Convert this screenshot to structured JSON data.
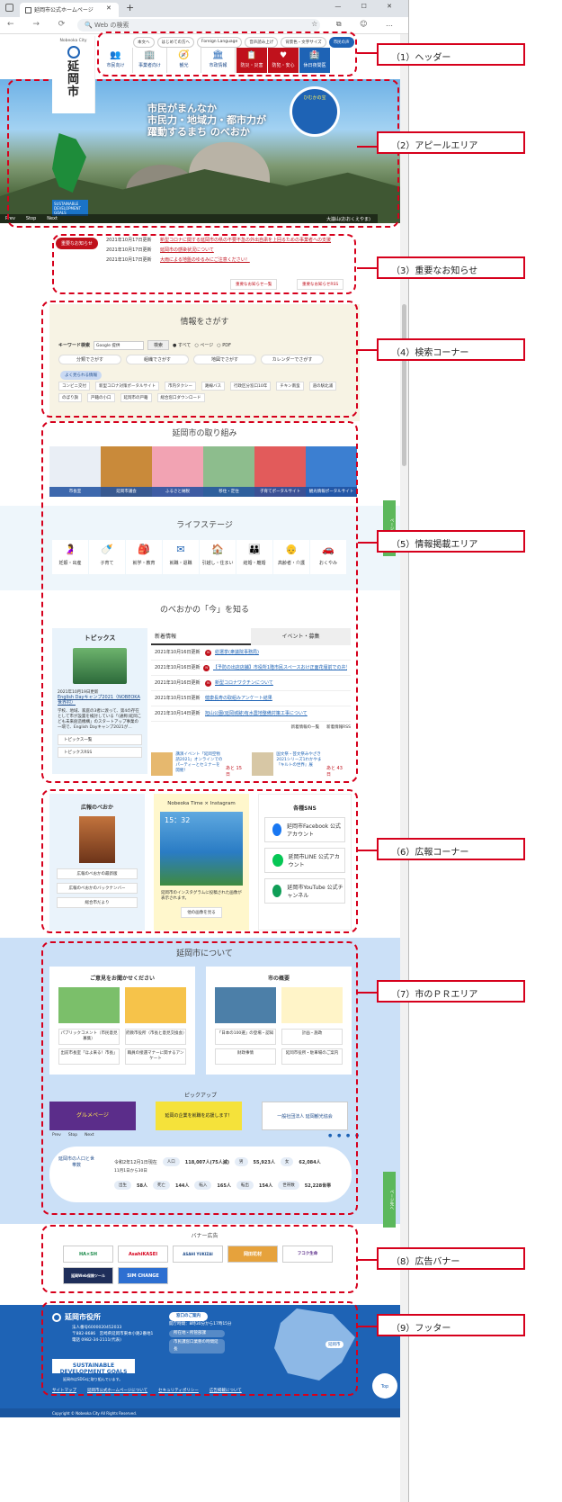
{
  "browser": {
    "tab_title": "延岡市公式ホームページ",
    "address_placeholder": "Web の検索"
  },
  "header": {
    "city_en": "Nobeoka City",
    "city_jp": "延岡市",
    "util": [
      "本文へ",
      "はじめての方へ",
      "Foreign Language",
      "音声読み上げ",
      "背景色・文字サイズ",
      "市民の声"
    ],
    "nav": [
      {
        "label": "市民向け",
        "icon": "👥"
      },
      {
        "label": "事業者向け",
        "icon": "🏢"
      },
      {
        "label": "観光",
        "icon": "🧭"
      },
      {
        "label": "市政情報",
        "icon": "🏛"
      }
    ],
    "nav_red": [
      {
        "label": "防災・災害",
        "icon": "📋"
      },
      {
        "label": "防犯・安心",
        "icon": "♥"
      }
    ],
    "nav_blue": {
      "label": "休日夜間医",
      "icon": "🏥"
    }
  },
  "hero": {
    "tagline": [
      "市民がまんなか",
      "市民力・地域力・都市力が",
      "躍動するまち のべおか"
    ],
    "circle_text": "ひむかの宝",
    "goals": "SUSTAINABLE DEVELOPMENT GOALS",
    "controls": [
      "Prev",
      "Stop",
      "Next"
    ],
    "caption": "大崩山(おおくえやま)"
  },
  "notice": {
    "label": "重要なお知らせ",
    "items": [
      {
        "date": "2021年10月17日更新",
        "text": "新型コロナに関する延岡市の県の不要不急の外出自粛を上回るための事業者への支援"
      },
      {
        "date": "2021年10月17日更新",
        "text": "延岡市の感染状況について"
      },
      {
        "date": "2021年10月17日更新",
        "text": "大雨による地盤のゆるみにご注意ください！"
      }
    ],
    "more1": "重要なお知らせ一覧",
    "more2": "重要なお知らせRSS"
  },
  "search": {
    "title": "情報をさがす",
    "kw_label": "キーワード検索",
    "kw_placeholder": "Google 提供",
    "kw_button": "検索",
    "scope": [
      "● すべて",
      "○ ページ",
      "○ PDF"
    ],
    "cats": [
      "分類でさがす",
      "組織でさがす",
      "地図でさがす",
      "カレンダーでさがす"
    ],
    "faq": "よく見られる情報",
    "tags": [
      "コンビニ交付",
      "新型コロナ対策ポータルサイト",
      "市内タクシー",
      "路線バス",
      "行政区分窓口10年",
      "チキン南蛮",
      "道の駅北浦",
      "のぼり旗",
      "戸籍の小口",
      "延岡市の戸籍",
      "総合窓口ダウンロード"
    ]
  },
  "initiatives": {
    "title": "延岡市の取り組み",
    "tiles": [
      {
        "label": "市長室",
        "color": "#e9eef5"
      },
      {
        "label": "延岡市議会",
        "color": "#c98a3a"
      },
      {
        "label": "ふるさと納税",
        "color": "#f2a3b3"
      },
      {
        "label": "移住・定住",
        "color": "#8dbd8d"
      },
      {
        "label": "子育てポータルサイト",
        "color": "#e25b5b"
      },
      {
        "label": "観光情報ポータルサイト",
        "color": "#3c7fd1"
      }
    ]
  },
  "lifestage": {
    "title": "ライフステージ",
    "items": [
      {
        "label": "妊娠・出産",
        "icon": "🤰"
      },
      {
        "label": "子育て",
        "icon": "🍼"
      },
      {
        "label": "就学・教育",
        "icon": "🎒"
      },
      {
        "label": "就職・退職",
        "icon": "✉"
      },
      {
        "label": "引越し・住まい",
        "icon": "🏠"
      },
      {
        "label": "結婚・離婚",
        "icon": "👪"
      },
      {
        "label": "高齢者・介護",
        "icon": "👴"
      },
      {
        "label": "おくやみ",
        "icon": "🚗"
      }
    ]
  },
  "now": {
    "title": "のべおかの「今」を知る",
    "topics": {
      "title": "トピックス",
      "date": "2021年10月19日更新",
      "link": "English Dayキャンプ2021（NOBEOKA 世界村）",
      "text": "学校、地域、家庭の3者に渡って、第4の存在として市が設置を検討している「(通称)延岡こども未来創造機構」のスタートアップ事業の一環で、English Dayキャンプ2021が…",
      "b1": "トピックス一覧",
      "b2": "トピックスRSS"
    },
    "tabs": [
      "新着情報",
      "イベント・募集"
    ],
    "news": [
      {
        "date": "2021年10月16日更新",
        "new": true,
        "text": "総選挙(衆議院事務局)"
      },
      {
        "date": "2021年10月16日更新",
        "new": true,
        "text": "【予防の出店店舗】市役所1階市民スペースおけ正面花壇前での弁当販売"
      },
      {
        "date": "2021年10月16日更新",
        "new": true,
        "text": "新型コロナワクチンについて"
      },
      {
        "date": "2021年10月15日更新",
        "new": false,
        "text": "健康長寿の取組みアンケート結果"
      },
      {
        "date": "2021年10月14日更新",
        "new": false,
        "text": "旭山公園(延岡城跡)有水農地整備対策工事について"
      }
    ],
    "news_more1": "新着情報の一覧",
    "news_more2": "新着情報RSS",
    "events": [
      {
        "text": "講演イベント「延岡空物語2021」オンラインでのパーティーとセミナーを開催！",
        "count": "あと 15 日"
      },
      {
        "text": "国文祭・芸文祭みやざき2021シリーズ1わかやま『キルトの世界』展",
        "count": "あと 43 日"
      }
    ]
  },
  "pr": {
    "koho": {
      "title": "広報のべおか",
      "b1": "広報のべおかの最新版",
      "b2": "広報のべおかのバックナンバー",
      "b3": "総合市だより"
    },
    "insta": {
      "head": "Nobeoka Time × Instagram",
      "time": "15：32",
      "text": "延岡市のインスタグラムに投稿された画像が表示されます。",
      "btn": "他の画像を見る"
    },
    "sns": {
      "title": "各種SNS",
      "items": [
        {
          "label": "延岡市Facebook 公式アカウント",
          "color": "#1877f2"
        },
        {
          "label": "延岡市LINE 公式アカウント",
          "color": "#06c755"
        },
        {
          "label": "延岡市YouTube 公式チャンネル",
          "color": "#0f9e57"
        }
      ]
    }
  },
  "city": {
    "title": "延岡市について",
    "opinion": {
      "title": "ご意見をお聞かせください",
      "links": [
        "パブリックコメント（市民意見募集）",
        "府教市役所（市長と意見交換会）",
        "出前市長室「ほよ来る！市長」",
        "職員の接遇マナーに関するアンケート"
      ]
    },
    "overview": {
      "title": "市の概要",
      "links": [
        "「日本の100選」の登場・認知",
        "計画・施政",
        "財政事情",
        "延岡市役所・駐車場のご案内"
      ]
    },
    "pickup": "ピックアップ",
    "pickup_items": [
      "グルメページ",
      "延岡の企業を就職を応援します！",
      "一般社団法人 延岡観光協会"
    ],
    "controls": [
      "Prev",
      "Stop",
      "Next"
    ],
    "pop": {
      "label": "延岡市の人口と世帯数",
      "as_of": "令和2年12月1日現在",
      "as_of2": "11月1日から30日",
      "r1": [
        {
          "k": "人口",
          "v": "118,007人(75人減)"
        },
        {
          "k": "男",
          "v": "55,923人"
        },
        {
          "k": "女",
          "v": "62,084人"
        }
      ],
      "r2": [
        {
          "k": "出生",
          "v": "58人"
        },
        {
          "k": "死亡",
          "v": "144人"
        },
        {
          "k": "転入",
          "v": "165人"
        },
        {
          "k": "転出",
          "v": "154人"
        },
        {
          "k": "世帯数",
          "v": "52,228世帯"
        }
      ]
    }
  },
  "banner": {
    "title": "バナー広告",
    "items": [
      "HA×SH",
      "AsahiKASEI",
      "ASAHI YUKIZAI",
      "岡田花材",
      "フコク生命",
      "延岡Web保険ツール",
      "SIM CHANGE"
    ]
  },
  "footer": {
    "name": "延岡市役所",
    "corp": "法人番号6000020452033",
    "addr": "〒882-8686　宮崎県延岡市東本小路2番地1",
    "tel": "電話 0982-34-2111(代表)",
    "window": "窓口のご案内",
    "hours": "開庁時間：8時30分から17時15分",
    "w1": "所在地・所管部課",
    "w2": "市民課窓口業務の時間延長",
    "city_label": "延岡市",
    "sdgs": "SUSTAINABLE DEVELOPMENT GOALS",
    "sdgs_text": "延岡市はSDGsに取り組んでいます。",
    "links": [
      "サイトマップ",
      "延岡市公式ホームページについて",
      "セキュリティポリシー",
      "広告掲載について"
    ],
    "top": "Top",
    "copyright": "Copyright © Nobeoka City All Rights Reserved."
  },
  "side_tabs": [
    "ページ先へ",
    "ページ先へ"
  ],
  "annotations": [
    "（1）ヘッダー",
    "（2）アピールエリア",
    "（3）重要なお知らせ",
    "（4）検索コーナー",
    "（5）情報掲載エリア",
    "（6）広報コーナー",
    "（7）市のＰＲエリア",
    "（8）広告バナー",
    "（9）フッター"
  ]
}
